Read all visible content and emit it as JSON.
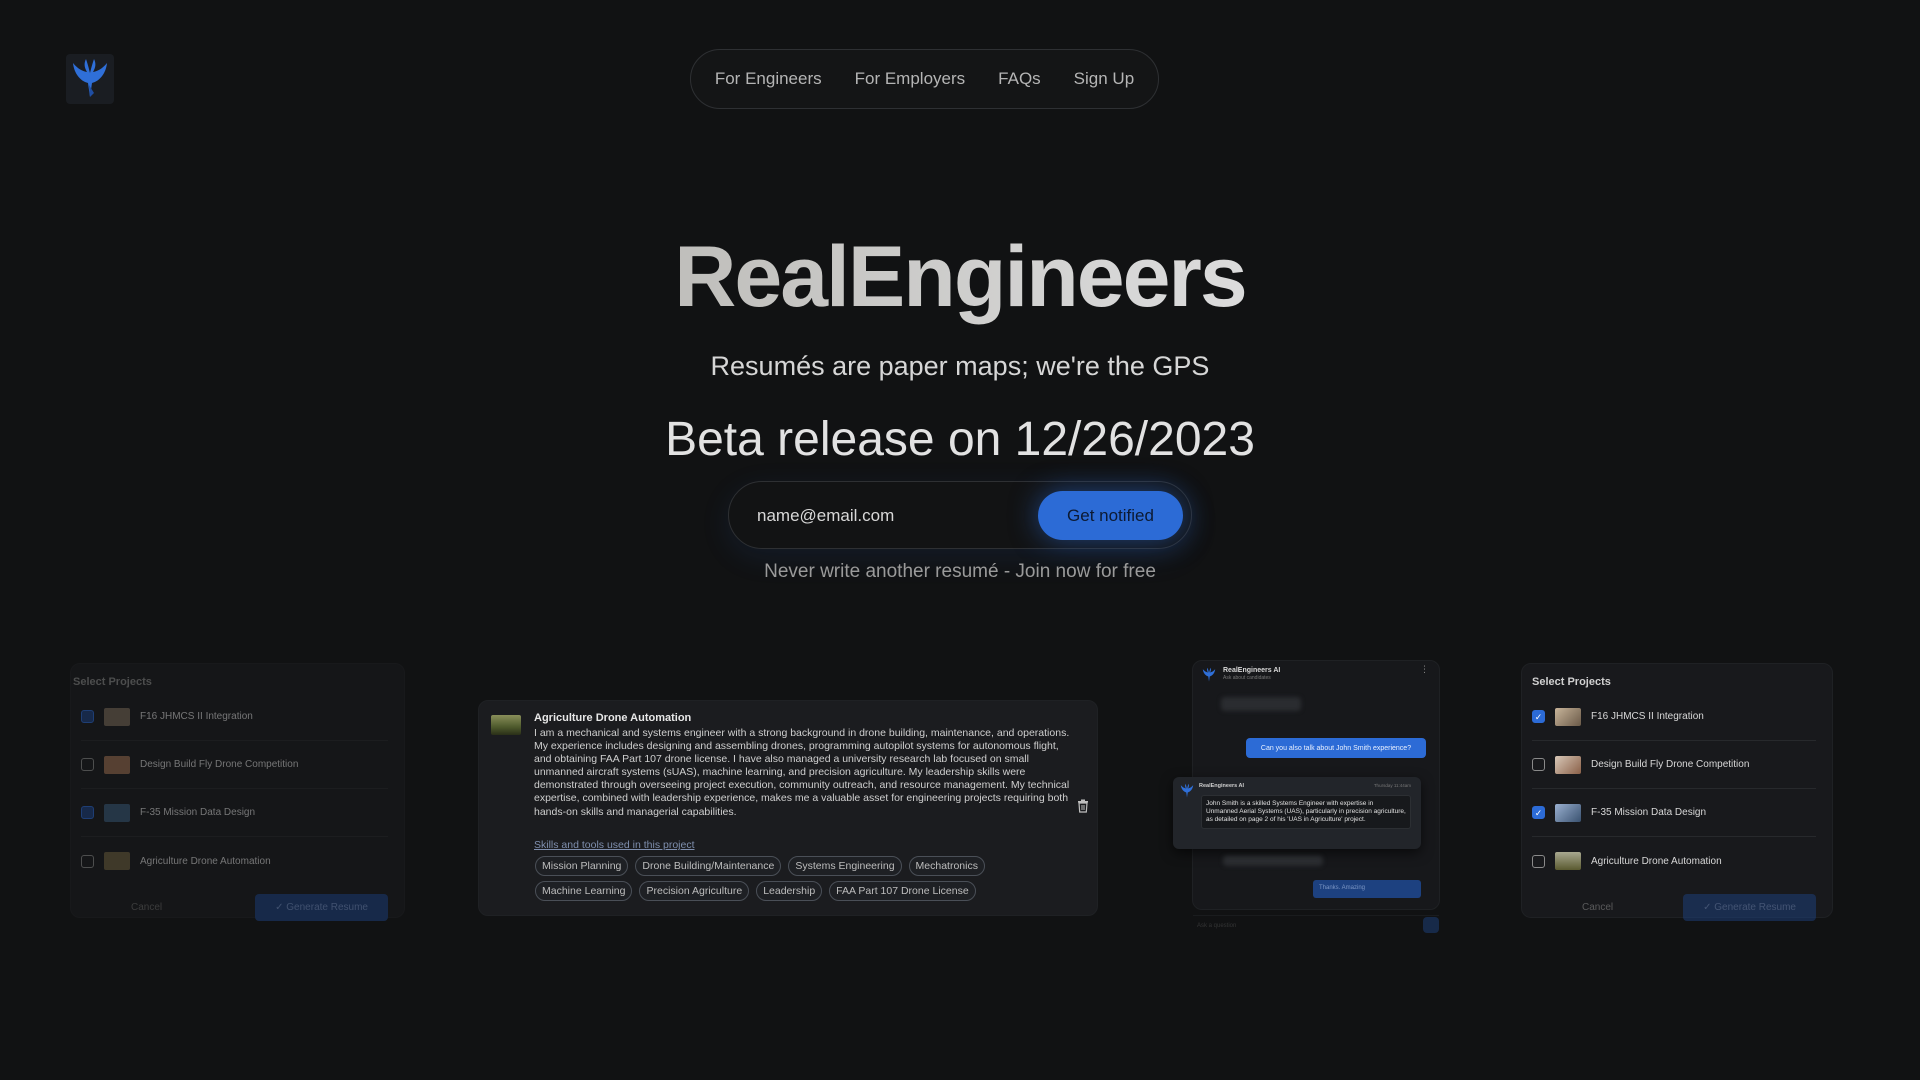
{
  "brand": {
    "logo_icon": "phoenix-logo-icon",
    "accent": "#2c6bd6"
  },
  "nav": {
    "items": [
      "For Engineers",
      "For Employers",
      "FAQs",
      "Sign Up"
    ]
  },
  "hero": {
    "title": "RealEngineers",
    "subtitle": "Resumés are paper maps; we're the GPS",
    "beta": "Beta release on 12/26/2023",
    "email_placeholder": "name@email.com",
    "notify_label": "Get notified",
    "tagline": "Never write another resumé - Join now for free"
  },
  "left_panel": {
    "title": "Select Projects",
    "projects": [
      {
        "name": "F16 JHMCS II Integration",
        "checked": true
      },
      {
        "name": "Design Build Fly Drone Competition",
        "checked": false
      },
      {
        "name": "F-35 Mission Data Design",
        "checked": true
      },
      {
        "name": "Agriculture Drone Automation",
        "checked": false
      }
    ],
    "cancel": "Cancel",
    "generate": "✓ Generate Resume"
  },
  "project_card": {
    "title": "Agriculture Drone Automation",
    "description": "I am a mechanical and systems engineer with a strong background in drone building, maintenance, and operations. My experience includes designing and assembling drones, programming autopilot systems for autonomous flight, and obtaining FAA Part 107 drone license. I have also managed a university research lab focused on small unmanned aircraft systems (sUAS), machine learning, and precision agriculture. My leadership skills were demonstrated through overseeing project execution, community outreach, and resource management. My technical expertise, combined with leadership experience, makes me a valuable asset for engineering projects requiring both hands-on skills and managerial capabilities.",
    "skills_link": "Skills and tools used in this project",
    "tags": [
      "Mission Planning",
      "Drone Building/Maintenance",
      "Systems Engineering",
      "Mechatronics",
      "Machine Learning",
      "Precision Agriculture",
      "Leadership",
      "FAA Part 107 Drone License"
    ]
  },
  "chat": {
    "name": "RealEngineers AI",
    "sub": "Ask about candidates",
    "user_msg": "Can you also talk about John Smith experience?",
    "ai_name": "RealEngineers AI",
    "ai_date": "Thursday 11:44am",
    "ai_msg": "John Smith is a skilled Systems Engineer with expertise in Unmanned Aerial Systems (UAS), particularly in precision agriculture, as detailed on page 2 of his 'UAS in Agriculture' project.",
    "reply": "Thanks. Amazing",
    "input_placeholder": "Ask a question"
  },
  "right_panel": {
    "title": "Select Projects",
    "projects": [
      {
        "name": "F16 JHMCS II Integration",
        "checked": true
      },
      {
        "name": "Design Build Fly Drone Competition",
        "checked": false
      },
      {
        "name": "F-35 Mission Data Design",
        "checked": true
      },
      {
        "name": "Agriculture Drone Automation",
        "checked": false
      }
    ],
    "cancel": "Cancel",
    "generate": "✓ Generate Resume"
  }
}
